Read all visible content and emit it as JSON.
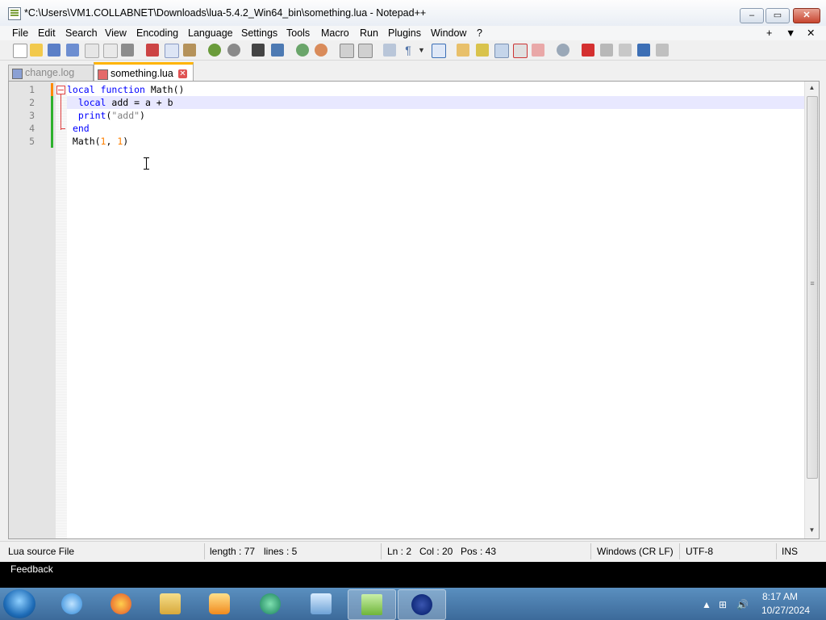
{
  "window": {
    "title": "*C:\\Users\\VM1.COLLABNET\\Downloads\\lua-5.4.2_Win64_bin\\something.lua - Notepad++",
    "minimize": "–",
    "maximize": "▭",
    "close": "✕"
  },
  "menu": {
    "items": [
      "File",
      "Edit",
      "Search",
      "View",
      "Encoding",
      "Language",
      "Settings",
      "Tools",
      "Macro",
      "Run",
      "Plugins",
      "Window",
      "?"
    ],
    "right": [
      "+",
      "▼",
      "✕"
    ]
  },
  "tabs": [
    {
      "label": "change.log"
    },
    {
      "label": "something.lua",
      "close": "✕"
    }
  ],
  "editor": {
    "line_numbers": [
      "1",
      "2",
      "3",
      "4",
      "5"
    ],
    "lines": [
      {
        "parts": [
          {
            "t": "kw",
            "v": "local"
          },
          {
            "t": "",
            "v": " "
          },
          {
            "t": "kw",
            "v": "function"
          },
          {
            "t": "",
            "v": " Math()"
          }
        ]
      },
      {
        "parts": [
          {
            "t": "",
            "v": "  "
          },
          {
            "t": "kw",
            "v": "local"
          },
          {
            "t": "",
            "v": " add = a + b"
          }
        ]
      },
      {
        "parts": [
          {
            "t": "",
            "v": "  "
          },
          {
            "t": "kw",
            "v": "print"
          },
          {
            "t": "",
            "v": "("
          },
          {
            "t": "str",
            "v": "\"add\""
          },
          {
            "t": "",
            "v": ")"
          }
        ]
      },
      {
        "parts": [
          {
            "t": "",
            "v": " "
          },
          {
            "t": "kw",
            "v": "end"
          }
        ]
      },
      {
        "parts": [
          {
            "t": "",
            "v": " Math("
          },
          {
            "t": "num",
            "v": "1"
          },
          {
            "t": "",
            "v": ", "
          },
          {
            "t": "num",
            "v": "1"
          },
          {
            "t": "",
            "v": ")"
          }
        ]
      }
    ],
    "vscroll_up": "▲",
    "vscroll_down": "▼",
    "vscroll_mid": "≡"
  },
  "status": {
    "file_type": "Lua source File",
    "length": "length : 77",
    "lines": "lines : 5",
    "ln": "Ln : 2",
    "col": "Col : 20",
    "pos": "Pos : 43",
    "eol": "Windows (CR LF)",
    "encoding": "UTF-8",
    "mode": "INS"
  },
  "feedback": {
    "label": "Feedback"
  },
  "taskbar": {
    "time": "8:17 AM",
    "date": "10/27/2024",
    "tray_icons": [
      "▲",
      "⊞",
      "🔊"
    ]
  },
  "colors": {
    "accent": "#ffb400",
    "keyword": "#0000ff",
    "number": "#ff8000"
  }
}
